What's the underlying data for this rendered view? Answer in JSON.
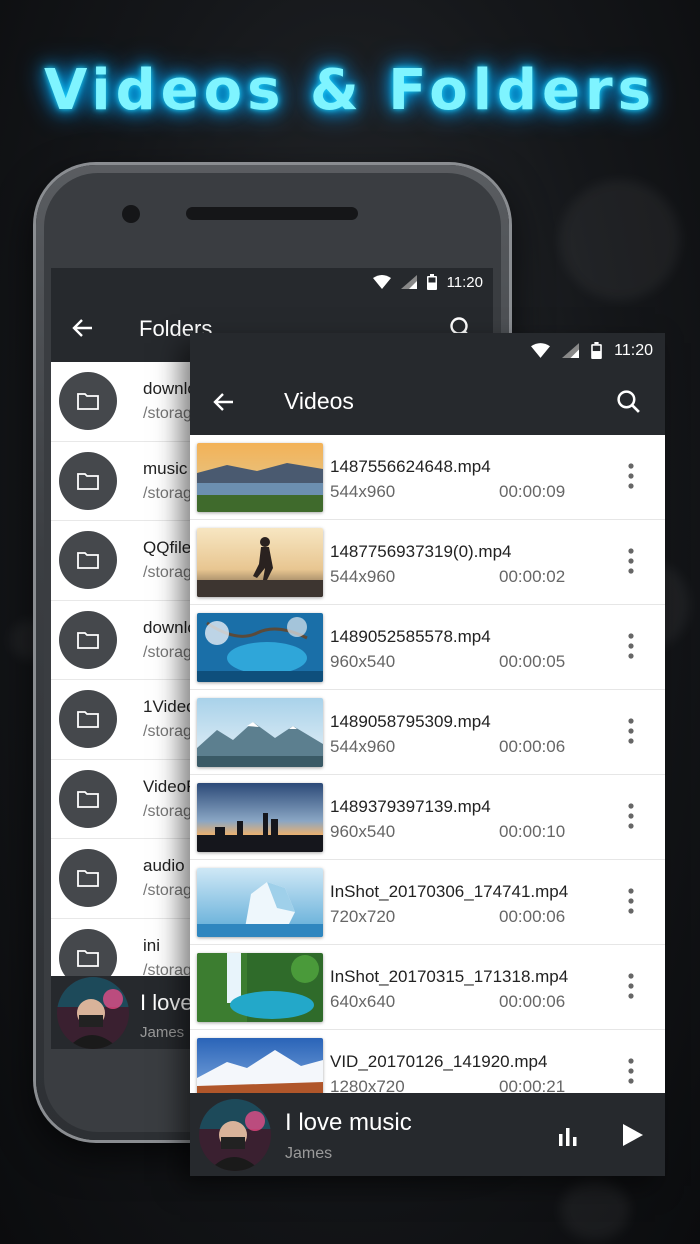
{
  "headline": "Videos & Folders",
  "colors": {
    "accent": "#7ff4ff",
    "appbar": "#26292d",
    "folder_circle": "#45484c"
  },
  "folders_screen": {
    "status_time": "11:20",
    "title": "Folders",
    "items": [
      {
        "name": "downlo",
        "path": "/storag"
      },
      {
        "name": "music",
        "path": "/storag"
      },
      {
        "name": "QQfile_",
        "path": "/storag"
      },
      {
        "name": "downlo",
        "path": "/storag"
      },
      {
        "name": "1Video",
        "path": "/storag"
      },
      {
        "name": "VideoF",
        "path": "/storag"
      },
      {
        "name": "audio",
        "path": "/storag"
      },
      {
        "name": "ini",
        "path": "/storag"
      }
    ],
    "now_playing": {
      "song": "I love",
      "artist": "James"
    }
  },
  "videos_screen": {
    "status_time": "11:20",
    "title": "Videos",
    "items": [
      {
        "name": "1487556624648.mp4",
        "resolution": "544x960",
        "duration": "00:00:09",
        "thumb": "sunset-lake"
      },
      {
        "name": "1487756937319(0).mp4",
        "resolution": "544x960",
        "duration": "00:00:02",
        "thumb": "runner"
      },
      {
        "name": "1489052585578.mp4",
        "resolution": "960x540",
        "duration": "00:00:05",
        "thumb": "blue-pond"
      },
      {
        "name": "1489058795309.mp4",
        "resolution": "544x960",
        "duration": "00:00:06",
        "thumb": "mountains"
      },
      {
        "name": "1489379397139.mp4",
        "resolution": "960x540",
        "duration": "00:00:10",
        "thumb": "city-dusk"
      },
      {
        "name": "InShot_20170306_174741.mp4",
        "resolution": "720x720",
        "duration": "00:00:06",
        "thumb": "iceberg"
      },
      {
        "name": "InShot_20170315_171318.mp4",
        "resolution": "640x640",
        "duration": "00:00:06",
        "thumb": "waterfall"
      },
      {
        "name": "VID_20170126_141920.mp4",
        "resolution": "1280x720",
        "duration": "00:00:21",
        "thumb": "snow-peak"
      }
    ],
    "now_playing": {
      "song": "I love music",
      "artist": "James"
    }
  }
}
